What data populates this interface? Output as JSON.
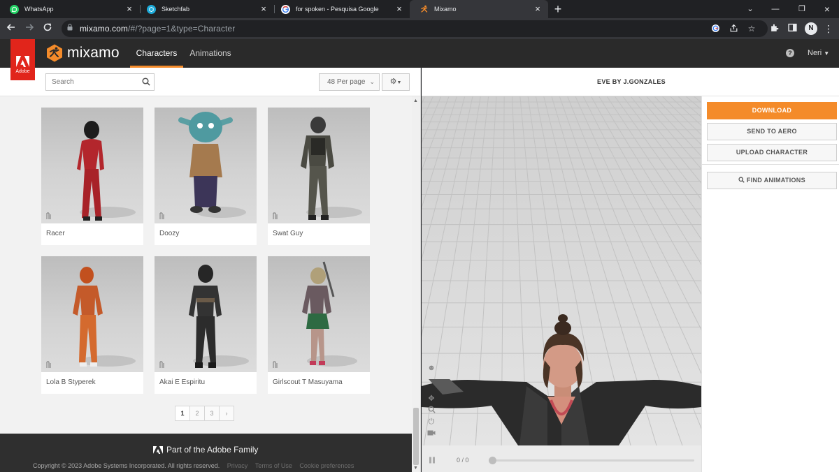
{
  "browser": {
    "tabs": [
      {
        "label": "WhatsApp",
        "icon": "whatsapp-icon",
        "color": "#25d366"
      },
      {
        "label": "Sketchfab",
        "icon": "sketchfab-icon",
        "color": "#1caad9"
      },
      {
        "label": "for spoken - Pesquisa Google",
        "icon": "google-icon",
        "color": "#ffffff"
      },
      {
        "label": "Mixamo",
        "icon": "mixamo-icon",
        "color": "#f48b2a"
      }
    ],
    "url_host": "mixamo.com",
    "url_rest": "/#/?page=1&type=Character",
    "profile_initial": "N"
  },
  "header": {
    "adobe_label": "Adobe",
    "brand": "mixamo",
    "nav": [
      "Characters",
      "Animations"
    ],
    "active_nav": "Characters",
    "user": "Neri"
  },
  "library": {
    "search_placeholder": "Search",
    "per_page": "48 Per page",
    "characters": [
      {
        "name": "Racer"
      },
      {
        "name": "Doozy"
      },
      {
        "name": "Swat Guy"
      },
      {
        "name": "Lola B Styperek"
      },
      {
        "name": "Akai E Espiritu"
      },
      {
        "name": "Girlscout T Masuyama"
      }
    ],
    "pages": [
      "1",
      "2",
      "3",
      "›"
    ],
    "active_page": "1"
  },
  "footer": {
    "family": "Part of the Adobe Family",
    "copyright": "Copyright © 2023 Adobe Systems Incorporated. All rights reserved.",
    "links": [
      "Privacy",
      "Terms of Use",
      "Cookie preferences"
    ]
  },
  "viewer": {
    "title": "EVE BY J.GONZALES",
    "frames": "0 / 0"
  },
  "actions": {
    "download": "DOWNLOAD",
    "send_to_aero": "SEND TO AERO",
    "upload_character": "UPLOAD CHARACTER",
    "find_animations": "FIND ANIMATIONS"
  },
  "colors": {
    "accent": "#f48b2a",
    "adobe_red": "#e1251b",
    "header_bg": "#2a2a2a"
  }
}
